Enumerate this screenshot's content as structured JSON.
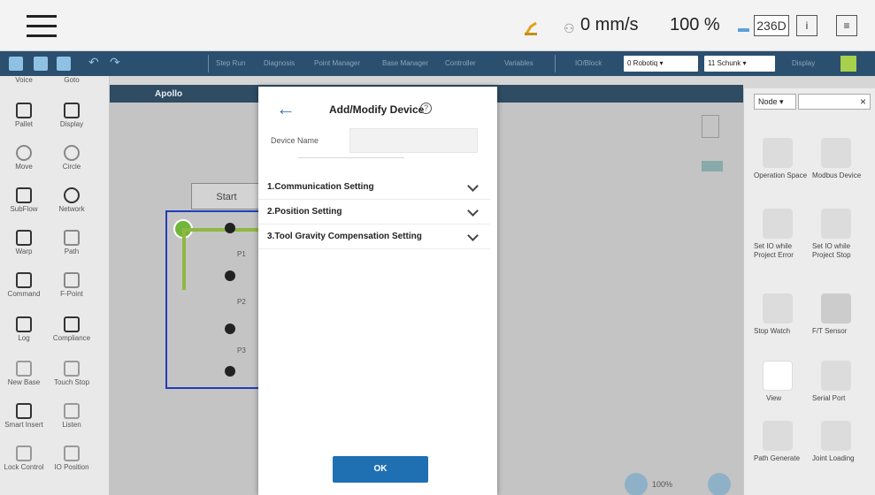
{
  "status": {
    "speed": "0 mm/s",
    "percent": "100 %",
    "badge": "236D",
    "info_label": "i",
    "log_label": "≡"
  },
  "toolbar": {
    "items": [
      "Step Run",
      "Diagnosis",
      "Point Manager",
      "Base Manager",
      "Controller",
      "Variables"
    ],
    "io_label": "IO/Block",
    "robot_select": "0 Robotiq",
    "tool_select": "11 Schunk",
    "display_label": "Display"
  },
  "palette": {
    "items": [
      "Voice",
      "Goto",
      "Pallet",
      "Display",
      "Move",
      "Circle",
      "SubFlow",
      "Network",
      "Warp",
      "Path",
      "Command",
      "F-Point",
      "Log",
      "Compliance",
      "New Base",
      "Touch Stop",
      "Smart Insert",
      "Listen",
      "Lock Control",
      "IO Position"
    ]
  },
  "canvas": {
    "project_name": "Apollo",
    "start_label": "Start",
    "nodes": [
      "P1",
      "P2",
      "P3"
    ],
    "zoom_label": "100%"
  },
  "right_panel": {
    "filter": "Node",
    "clear": "×",
    "items": [
      "Operation Space",
      "Modbus Device",
      "Set IO while Project Error",
      "Set IO while Project Stop",
      "Stop Watch",
      "F/T Sensor",
      "View",
      "Serial Port",
      "Path Generate",
      "Joint Loading"
    ]
  },
  "modal": {
    "title": "Add/Modify Device",
    "help": "?",
    "device_name_label": "Device Name",
    "sections": [
      "1.Communication Setting",
      "2.Position Setting",
      "3.Tool Gravity Compensation Setting"
    ],
    "ok_label": "OK"
  }
}
